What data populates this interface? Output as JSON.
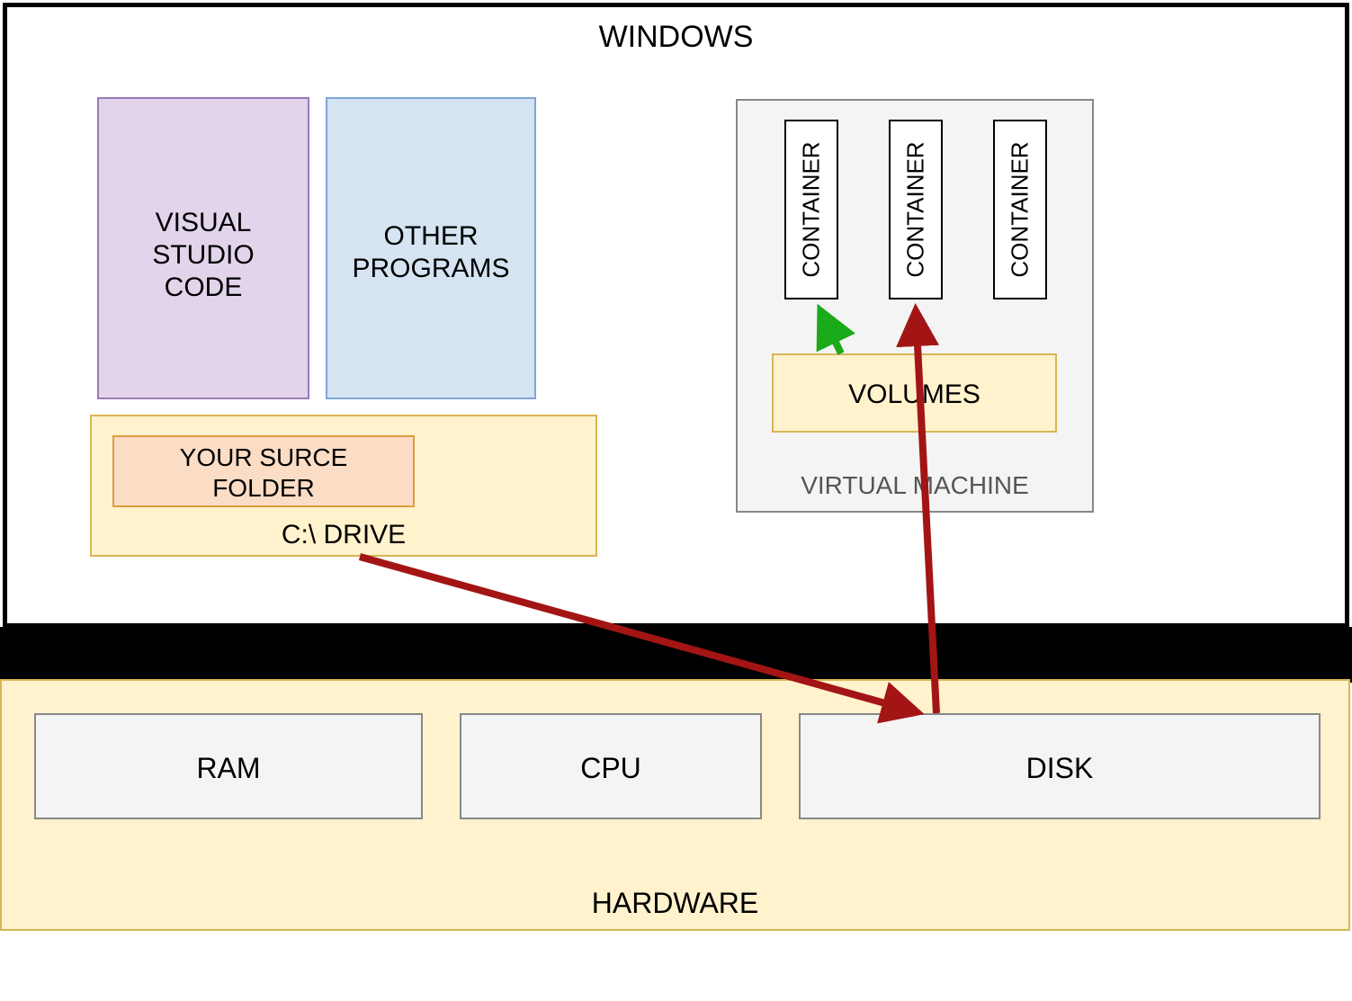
{
  "windows": {
    "title": "WINDOWS"
  },
  "vscode": {
    "label": "VISUAL\nSTUDIO\nCODE"
  },
  "other_programs": {
    "label": "OTHER\nPROGRAMS"
  },
  "cdrive": {
    "label": "C:\\ DRIVE"
  },
  "source_folder": {
    "label": "YOUR SURCE\nFOLDER"
  },
  "vm": {
    "label": "VIRTUAL MACHINE"
  },
  "containers": [
    {
      "label": "CONTAINER"
    },
    {
      "label": "CONTAINER"
    },
    {
      "label": "CONTAINER"
    }
  ],
  "volumes": {
    "label": "VOLUMES"
  },
  "hardware": {
    "label": "HARDWARE",
    "ram": "RAM",
    "cpu": "CPU",
    "disk": "DISK"
  },
  "arrows": {
    "cdrive_to_disk": {
      "color": "#a31515"
    },
    "disk_to_container": {
      "color": "#a31515"
    },
    "volumes_to_container": {
      "color": "#1aaa1a"
    }
  }
}
